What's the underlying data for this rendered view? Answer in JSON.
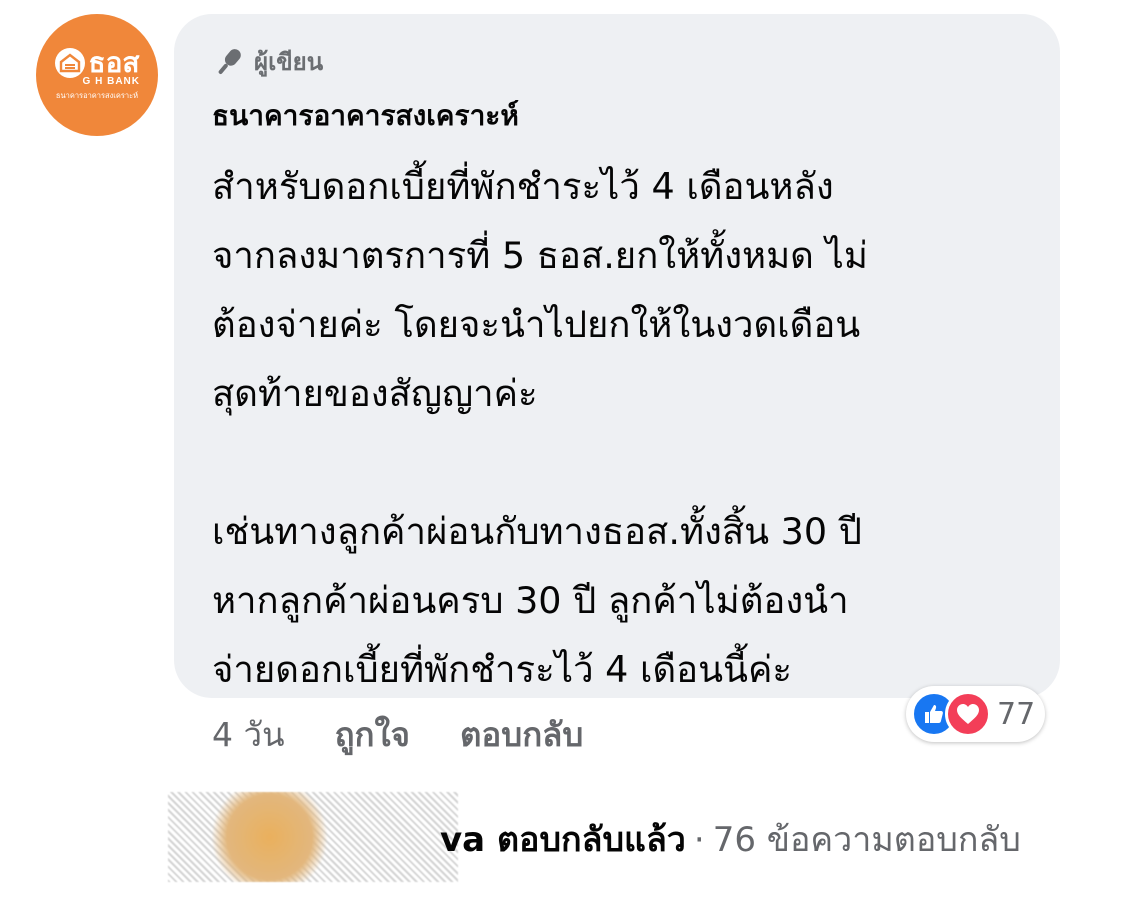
{
  "avatar": {
    "logo_text": "ธอส",
    "logo_sub": "G H BANK",
    "logo_name": "ธนาคารอาคารสงเคราะห์"
  },
  "comment": {
    "badge_label": "ผู้เขียน",
    "author": "ธนาคารอาคารสงเคราะห์",
    "paragraph1": [
      "สำหรับดอกเบี้ยที่พักชำระไว้ 4 เดือนหลัง",
      "จากลงมาตรการที่ 5 ธอส.ยกให้ทั้งหมด ไม่",
      "ต้องจ่ายค่ะ โดยจะนำไปยกให้ในงวดเดือน",
      "สุดท้ายของสัญญาค่ะ"
    ],
    "paragraph2": [
      "เช่นทางลูกค้าผ่อนกับทางธอส.ทั้งสิ้น 30 ปี",
      "หากลูกค้าผ่อนครบ 30 ปี ลูกค้าไม่ต้องนำ",
      "จ่ายดอกเบี้ยที่พักชำระไว้ 4 เดือนนี้ค่ะ"
    ]
  },
  "actions": {
    "time": "4 วัน",
    "like": "ถูกใจ",
    "reply": "ตอบกลับ"
  },
  "reactions": {
    "icons": [
      "like-icon",
      "love-icon"
    ],
    "count": "77",
    "colors": {
      "like": "#1877f2",
      "love": "#f33e58"
    }
  },
  "reply_summary": {
    "who": "va ตอบกลับแล้ว",
    "separator": "·",
    "count_text": "76 ข้อความตอบกลับ"
  }
}
